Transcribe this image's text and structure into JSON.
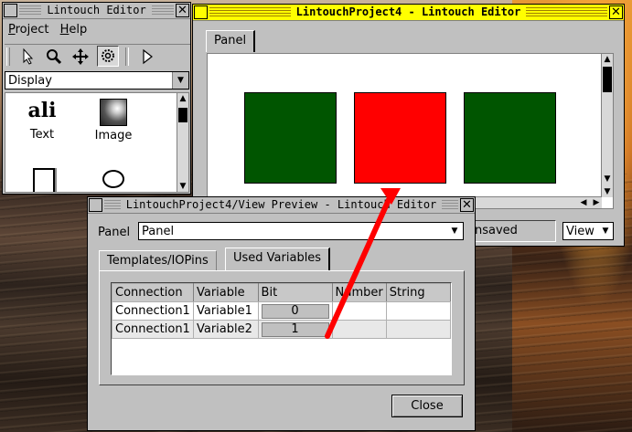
{
  "editor_window": {
    "title": "Lintouch Editor",
    "menu": [
      "Project",
      "Help"
    ],
    "category": "Display",
    "palette": [
      {
        "label": "Text",
        "icon": "text-tool-icon"
      },
      {
        "label": "Image",
        "icon": "image-tool-icon"
      },
      {
        "label": "",
        "icon": "rectangle-tool-icon"
      },
      {
        "label": "",
        "icon": "ellipse-tool-icon"
      }
    ],
    "toolbar_icons": [
      "pointer-icon",
      "zoom-icon",
      "move-icon",
      "gear-icon",
      "play-icon"
    ]
  },
  "project_window": {
    "title": "LintouchProject4 - Lintouch Editor",
    "tab": "Panel",
    "status_text": "nsaved",
    "view_select": "View",
    "squares": [
      {
        "color": "#005500"
      },
      {
        "color": "#ff0000"
      },
      {
        "color": "#005500"
      }
    ]
  },
  "preview_window": {
    "title": "LintouchProject4/View Preview - Lintouch Editor",
    "panel_label": "Panel",
    "panel_value": "Panel",
    "tabs": [
      "Templates/IOPins",
      "Used Variables"
    ],
    "active_tab": "Used Variables",
    "table": {
      "headers": [
        "Connection",
        "Variable",
        "Bit",
        "Number",
        "String"
      ],
      "rows": [
        {
          "connection": "Connection1",
          "variable": "Variable1",
          "bit": "0",
          "number": "",
          "string": ""
        },
        {
          "connection": "Connection1",
          "variable": "Variable2",
          "bit": "1",
          "number": "",
          "string": ""
        }
      ]
    },
    "close_label": "Close"
  },
  "annotation_arrow": {
    "color": "#ff0000"
  }
}
